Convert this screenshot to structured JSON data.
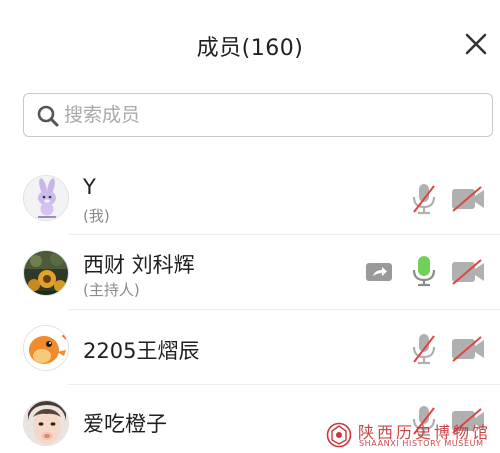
{
  "header": {
    "title": "成员(160)"
  },
  "search": {
    "placeholder": "搜索成员"
  },
  "members": [
    {
      "name": "Y",
      "sub": "(我)",
      "mic": "muted",
      "camera": "off"
    },
    {
      "name": "西财 刘科辉",
      "sub": "(主持人)",
      "mic": "active",
      "camera": "off",
      "sharing": true
    },
    {
      "name": "2205王熠辰",
      "mic": "muted",
      "camera": "off"
    },
    {
      "name": "爱吃橙子",
      "mic": "muted",
      "camera": "off"
    }
  ],
  "watermark": {
    "main": "陕西历史博物馆",
    "sub": "SHAANXI HISTORY MUSEUM"
  },
  "colors": {
    "mic_active": "#6fd15a",
    "muted_slash": "#e0443f",
    "icon_gray": "#b0b0b0",
    "watermark": "#c8373a"
  }
}
